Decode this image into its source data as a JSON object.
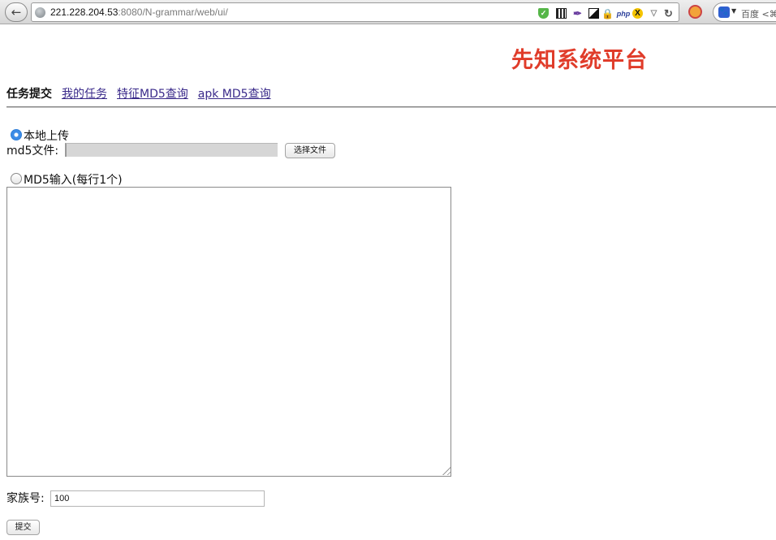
{
  "browser": {
    "url_host": "221.228.204.53",
    "url_path": ":8080/N-grammar/web/ui/",
    "search_text": "百度 <⌘",
    "icons": [
      "back-arrow-icon",
      "globe-icon",
      "shield-icon",
      "qr-code-icon",
      "feather-icon",
      "contrast-icon",
      "lock-icon",
      "php-icon",
      "x-icon",
      "dropmark-icon",
      "reload-icon",
      "addon-icon",
      "baidu-paw-icon"
    ]
  },
  "header": {
    "title": "先知系统平台",
    "title_color": "#e03c2a"
  },
  "nav": {
    "current": "任务提交",
    "links": [
      "我的任务",
      "特征MD5查询",
      "apk MD5查询"
    ],
    "link_color": "#3a2a8a"
  },
  "form": {
    "local_upload_label": "本地上传",
    "local_upload_checked": true,
    "md5_file_label": "md5文件:",
    "choose_file_label": "选择文件",
    "md5_input_label": "MD5输入(每行1个)",
    "md5_input_checked": false,
    "md5_textarea_value": "",
    "family_label": "家族号:",
    "family_value": "100",
    "submit_label": "提交"
  }
}
